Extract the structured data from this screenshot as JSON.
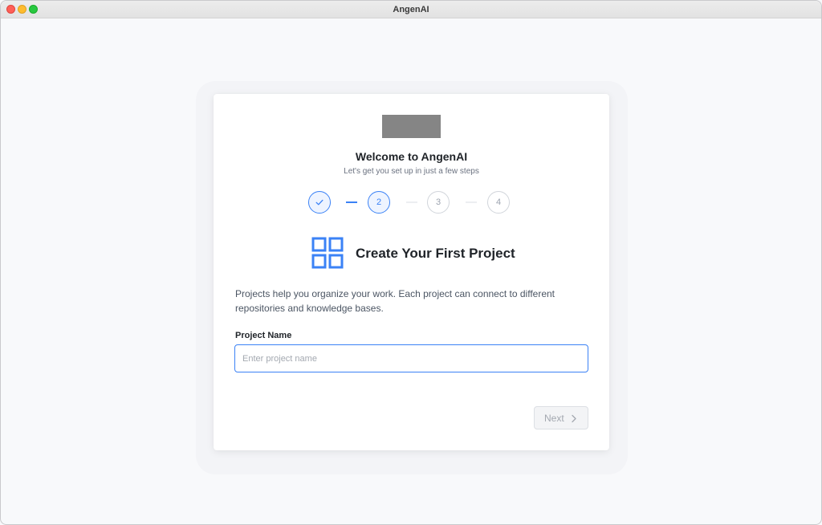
{
  "window": {
    "title": "AngenAI"
  },
  "onboarding": {
    "logo": "logo-placeholder",
    "title": "Welcome to AngenAI",
    "subtitle": "Let's get you set up in just a few steps",
    "steps": [
      {
        "label": "",
        "status": "completed",
        "icon": "check-icon"
      },
      {
        "label": "2",
        "status": "current"
      },
      {
        "label": "3",
        "status": "upcoming"
      },
      {
        "label": "4",
        "status": "upcoming"
      }
    ],
    "section": {
      "icon": "grid-icon",
      "title": "Create Your First Project",
      "description": "Projects help you organize your work. Each project can connect to different repositories and knowledge bases."
    },
    "project_name": {
      "label": "Project Name",
      "value": "",
      "placeholder": "Enter project name"
    },
    "next_button": {
      "label": "Next",
      "icon": "chevron-right-icon",
      "disabled": true
    }
  },
  "colors": {
    "accent": "#3b82f6",
    "muted": "#9ca3af",
    "background": "#f8f9fb"
  }
}
